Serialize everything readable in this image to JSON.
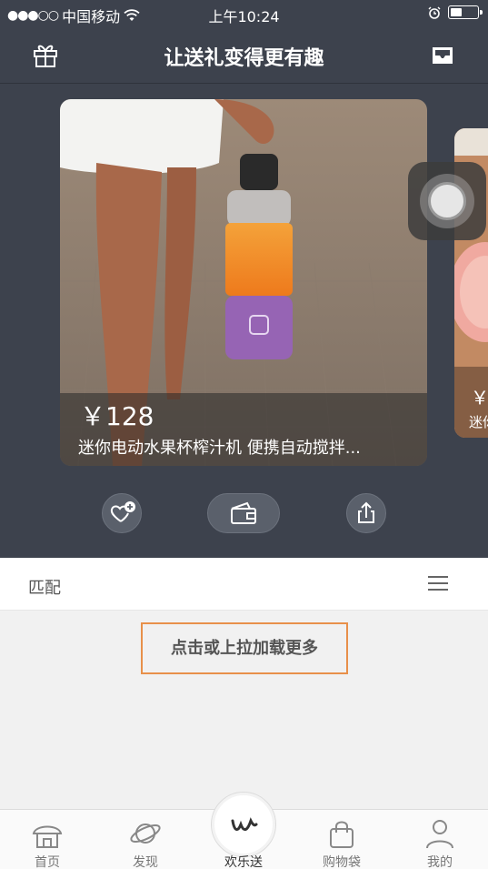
{
  "status_bar": {
    "signal": "●●●○○",
    "carrier": "中国移动",
    "time": "上午10:24"
  },
  "header": {
    "title": "让送礼变得更有趣",
    "left_icon": "gift-icon",
    "right_icon": "inbox-icon"
  },
  "product_card": {
    "price": "￥128",
    "description": "迷你电动水果杯榨汁机 便携自动搅拌..."
  },
  "next_card": {
    "price": "￥",
    "description": "迷你"
  },
  "actions": {
    "like_icon": "heart-add-icon",
    "wallet_icon": "wallet-icon",
    "share_icon": "share-icon"
  },
  "match_bar": {
    "label": "匹配",
    "menu_icon": "menu-icon"
  },
  "load_more": "点击或上拉加载更多",
  "tabbar": {
    "tabs": [
      {
        "label": "首页",
        "icon": "home-icon"
      },
      {
        "label": "发现",
        "icon": "planet-icon"
      },
      {
        "label": "欢乐送",
        "icon": "w-logo-icon"
      },
      {
        "label": "购物袋",
        "icon": "bag-icon"
      },
      {
        "label": "我的",
        "icon": "user-icon"
      }
    ]
  },
  "colors": {
    "header_bg": "#3d424d",
    "highlight_border": "#e8904a",
    "page_bg": "#f1f1f1"
  }
}
